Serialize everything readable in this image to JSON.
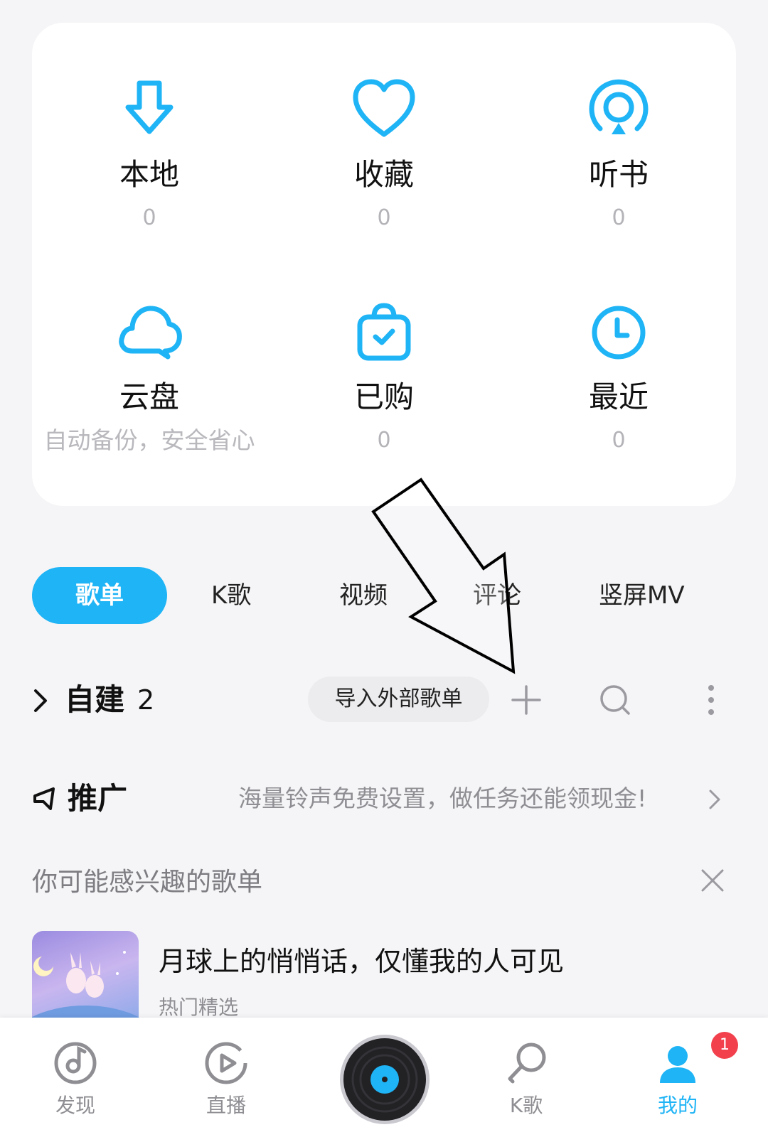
{
  "colors": {
    "accent": "#1fb4f5",
    "badge": "#f2414d"
  },
  "grid": [
    {
      "icon": "download-arrow-icon",
      "label": "本地",
      "count": "0"
    },
    {
      "icon": "heart-icon",
      "label": "收藏",
      "count": "0"
    },
    {
      "icon": "podcast-icon",
      "label": "听书",
      "count": "0"
    },
    {
      "icon": "cloud-icon",
      "label": "云盘",
      "sub": "自动备份，安全省心"
    },
    {
      "icon": "purchased-bag-icon",
      "label": "已购",
      "count": "0"
    },
    {
      "icon": "clock-icon",
      "label": "最近",
      "count": "0"
    }
  ],
  "tabs": [
    "歌单",
    "K歌",
    "视频",
    "评论",
    "竖屏MV"
  ],
  "self_built": {
    "title": "自建",
    "count": "2",
    "import_label": "导入外部歌单"
  },
  "promo": {
    "title": "推广",
    "text": "海量铃声免费设置，做任务还能领现金!"
  },
  "recommend": {
    "title": "你可能感兴趣的歌单"
  },
  "playlist": {
    "title": "月球上的悄悄话，仅懂我的人可见",
    "subtitle": "热门精选"
  },
  "nav": {
    "discover": "发现",
    "live": "直播",
    "ksong": "K歌",
    "mine": "我的",
    "badge": "1"
  }
}
